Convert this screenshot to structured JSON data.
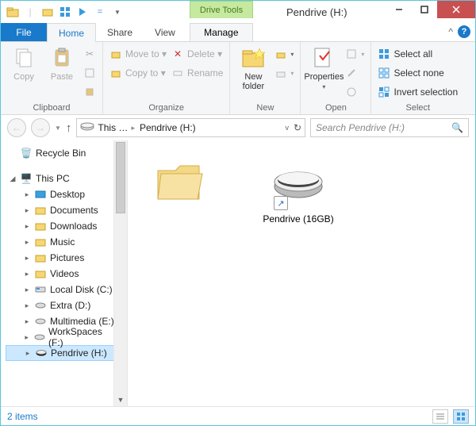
{
  "titlebar": {
    "drive_tools": "Drive Tools",
    "title": "Pendrive (H:)"
  },
  "tabs": {
    "file": "File",
    "home": "Home",
    "share": "Share",
    "view": "View",
    "manage": "Manage"
  },
  "ribbon": {
    "clipboard": {
      "copy": "Copy",
      "paste": "Paste",
      "label": "Clipboard"
    },
    "organize": {
      "move_to": "Move to ▾",
      "copy_to": "Copy to ▾",
      "delete": "Delete ▾",
      "rename": "Rename",
      "label": "Organize"
    },
    "new": {
      "newfolder": "New\nfolder",
      "label": "New"
    },
    "open": {
      "properties": "Properties",
      "label": "Open"
    },
    "select": {
      "select_all": "Select all",
      "select_none": "Select none",
      "invert": "Invert selection",
      "label": "Select"
    }
  },
  "breadcrumb": {
    "seg1": "This …",
    "seg2": "Pendrive (H:)"
  },
  "search": {
    "placeholder": "Search Pendrive (H:)"
  },
  "tree": {
    "recycle": "Recycle Bin",
    "thispc": "This PC",
    "desktop": "Desktop",
    "documents": "Documents",
    "downloads": "Downloads",
    "music": "Music",
    "pictures": "Pictures",
    "videos": "Videos",
    "localc": "Local Disk (C:)",
    "extrad": "Extra (D:)",
    "multie": "Multimedia (E:)",
    "workf": "WorkSpaces (F:)",
    "pendh": "Pendrive (H:)"
  },
  "content": {
    "folder_label": "",
    "shortcut_label": "Pendrive (16GB)"
  },
  "status": {
    "items": "2 items"
  }
}
